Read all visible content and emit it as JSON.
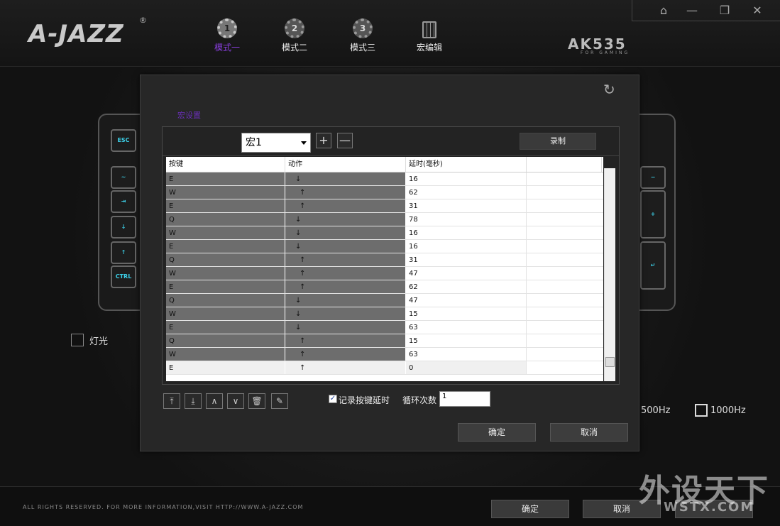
{
  "header": {
    "logo": "A-JAZZ",
    "logo_reg": "®",
    "tabs": [
      {
        "number": "1",
        "label": "模式一"
      },
      {
        "number": "2",
        "label": "模式二"
      },
      {
        "number": "3",
        "label": "模式三"
      },
      {
        "label": "宏编辑"
      }
    ],
    "active_tab": 0,
    "model": "AK535",
    "model_sub": "FOR GAMING",
    "window_controls": {
      "home": "⌂",
      "minimize": "—",
      "restore": "❐",
      "close": "✕"
    },
    "accent_color": "#8a3fe0"
  },
  "keyboard": {
    "left_keys": [
      "ESC",
      "~",
      "⇥",
      "↓",
      "↑",
      "CTRL"
    ],
    "right_keys": [
      "−",
      "+",
      "↵"
    ]
  },
  "background_options": {
    "light_label": "灯光",
    "hz500_label": "500Hz",
    "hz1000_label": "1000Hz"
  },
  "modal": {
    "refresh_icon": "↻",
    "title": "宏设置",
    "macro_select": "宏1",
    "add_button": "+",
    "remove_button": "—",
    "record_button": "录制",
    "columns": [
      "按键",
      "动作",
      "延时(毫秒)",
      ""
    ],
    "rows": [
      {
        "key": "E",
        "action": "↓",
        "delay": "16"
      },
      {
        "key": "W",
        "action": "↑",
        "delay": "62"
      },
      {
        "key": "E",
        "action": "↑",
        "delay": "31"
      },
      {
        "key": "Q",
        "action": "↓",
        "delay": "78"
      },
      {
        "key": "W",
        "action": "↓",
        "delay": "16"
      },
      {
        "key": "E",
        "action": "↓",
        "delay": "16"
      },
      {
        "key": "Q",
        "action": "↑",
        "delay": "31"
      },
      {
        "key": "W",
        "action": "↑",
        "delay": "47"
      },
      {
        "key": "E",
        "action": "↑",
        "delay": "62"
      },
      {
        "key": "Q",
        "action": "↓",
        "delay": "47"
      },
      {
        "key": "W",
        "action": "↓",
        "delay": "15"
      },
      {
        "key": "E",
        "action": "↓",
        "delay": "63"
      },
      {
        "key": "Q",
        "action": "↑",
        "delay": "15"
      },
      {
        "key": "W",
        "action": "↑",
        "delay": "63"
      },
      {
        "key": "E",
        "action": "↑",
        "delay": "0"
      }
    ],
    "selected_row": 14,
    "toolbar": {
      "top": "⤒",
      "bottom": "⤓",
      "up": "∧",
      "down": "∨",
      "delete": "🗑",
      "clear": "✎"
    },
    "record_delay_checked": "✓",
    "record_delay_label": "记录按键延时",
    "loop_label": "循环次数",
    "loop_value": "1",
    "ok_button": "确定",
    "cancel_button": "取消"
  },
  "footer": {
    "copyright": "ALL RIGHTS RESERVED. FOR MORE INFORMATION,VISIT HTTP://WWW.A-JAZZ.COM",
    "ok_button": "确定",
    "cancel_button": "取消",
    "watermark": "外设天下",
    "watermark_url": "WSTX.COM"
  }
}
